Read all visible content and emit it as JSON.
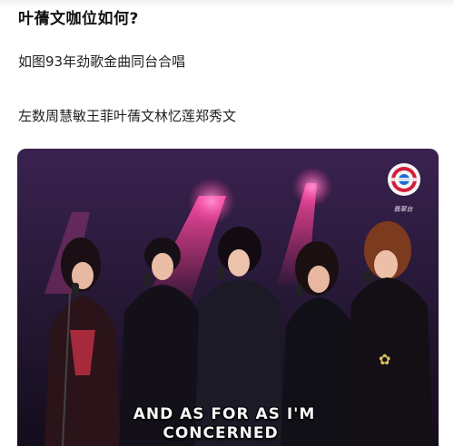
{
  "post": {
    "question_title": "叶蒨文咖位如何?",
    "line1": "如图93年劲歌金曲同台合唱",
    "line2": "左数周慧敏王菲叶蒨文林忆莲郑秀文"
  },
  "video": {
    "subtitle_line1": "AND AS FOR AS I'M",
    "subtitle_line2": "CONCERNED",
    "watermark_text": "翡翠台",
    "logo_icon": "tvb-logo-icon"
  }
}
